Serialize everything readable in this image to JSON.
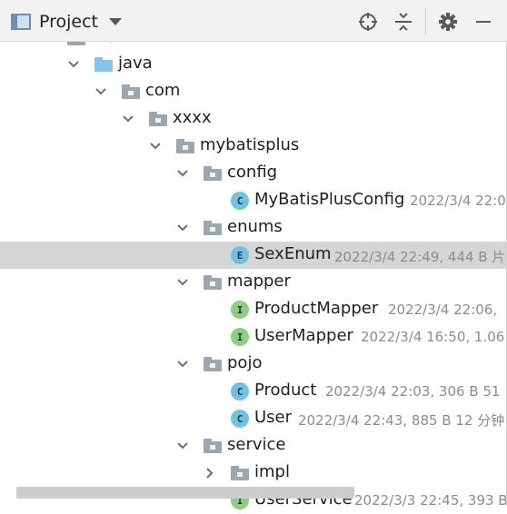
{
  "toolbar": {
    "title": "Project",
    "icons": [
      "locate-icon",
      "collapse-all-icon",
      "gear-icon",
      "minimize-icon"
    ]
  },
  "tree": [
    {
      "label": "main",
      "meta": "",
      "kind": "folder-gray"
    },
    {
      "label": "java",
      "meta": "",
      "kind": "folder-blue"
    },
    {
      "label": "com",
      "meta": "",
      "kind": "folder-gray"
    },
    {
      "label": "xxxx",
      "meta": "",
      "kind": "folder-gray"
    },
    {
      "label": "mybatisplus",
      "meta": "",
      "kind": "folder-gray"
    },
    {
      "label": "config",
      "meta": "",
      "kind": "folder-gray"
    },
    {
      "label": "MyBatisPlusConfig",
      "meta": "2022/3/4 22:0",
      "kind": "class",
      "badge": "C"
    },
    {
      "label": "enums",
      "meta": "",
      "kind": "folder-gray"
    },
    {
      "label": "SexEnum",
      "meta": "2022/3/4 22:49, 444 B 片",
      "kind": "enum",
      "badge": "E"
    },
    {
      "label": "mapper",
      "meta": "",
      "kind": "folder-gray"
    },
    {
      "label": "ProductMapper",
      "meta": "2022/3/4 22:06, ",
      "kind": "interface",
      "badge": "I"
    },
    {
      "label": "UserMapper",
      "meta": "2022/3/4 16:50, 1.06",
      "kind": "interface",
      "badge": "I"
    },
    {
      "label": "pojo",
      "meta": "",
      "kind": "folder-gray"
    },
    {
      "label": "Product",
      "meta": "2022/3/4 22:03, 306 B 51 ",
      "kind": "class",
      "badge": "C"
    },
    {
      "label": "User",
      "meta": "2022/3/4 22:43, 885 B 12 分钟",
      "kind": "class",
      "badge": "C"
    },
    {
      "label": "service",
      "meta": "",
      "kind": "folder-gray"
    },
    {
      "label": "impl",
      "meta": "",
      "kind": "folder-gray"
    },
    {
      "label": "UserService",
      "meta": "2022/3/3 22:45, 393 B",
      "kind": "interface",
      "badge": "I"
    }
  ],
  "colors": {
    "folder_gray": "#9aa7b0",
    "folder_blue": "#87c3e8",
    "class_badge": "#6fc2e4",
    "interface_badge": "#8ccf7f",
    "enum_badge": "#6fc2e4",
    "selection": "#d5d5d5"
  }
}
